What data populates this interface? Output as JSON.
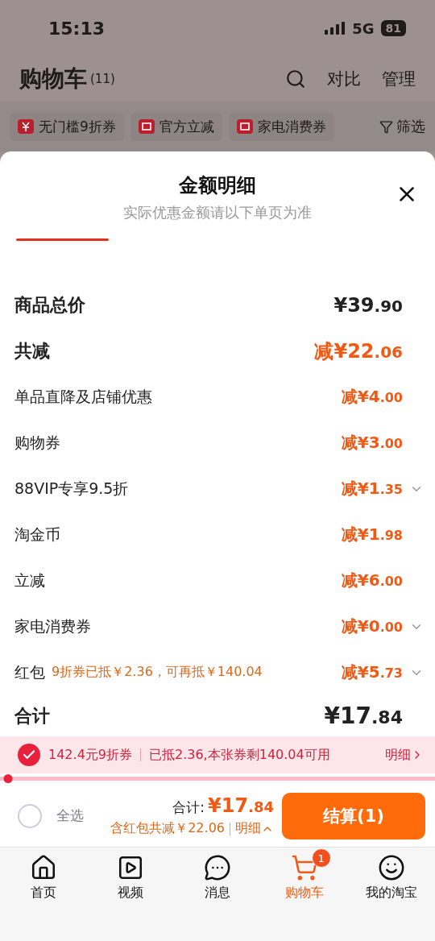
{
  "status_bar": {
    "time": "15:13",
    "network": "5G",
    "battery": "81"
  },
  "header": {
    "title": "购物车",
    "count": "(11)",
    "actions": [
      "对比",
      "管理"
    ]
  },
  "chips": [
    {
      "label": "无门槛9折券"
    },
    {
      "label": "官方立减"
    },
    {
      "label": "家电消费券"
    }
  ],
  "filter": "筛选",
  "sheet": {
    "title": "金额明细",
    "subtitle": "实际优惠金额请以下单页为准",
    "rows": [
      {
        "kind": "summary",
        "label": "商品总价",
        "amount": "¥39",
        "cents": ".90",
        "discount": false,
        "chevron": false
      },
      {
        "kind": "summary",
        "label": "共减",
        "amount": "减¥22",
        "cents": ".06",
        "discount": true,
        "chevron": false
      },
      {
        "kind": "detail",
        "label": "单品直降及店铺优惠",
        "amount": "减¥4",
        "cents": ".00",
        "discount": true,
        "chevron": false
      },
      {
        "kind": "detail",
        "label": "购物券",
        "amount": "减¥3",
        "cents": ".00",
        "discount": true,
        "chevron": false
      },
      {
        "kind": "detail",
        "label": "88VIP专享9.5折",
        "amount": "减¥1",
        "cents": ".35",
        "discount": true,
        "chevron": true
      },
      {
        "kind": "detail",
        "label": "淘金币",
        "amount": "减¥1",
        "cents": ".98",
        "discount": true,
        "chevron": false
      },
      {
        "kind": "detail",
        "label": "立减",
        "amount": "减¥6",
        "cents": ".00",
        "discount": true,
        "chevron": false
      },
      {
        "kind": "detail",
        "label": "家电消费券",
        "amount": "减¥0",
        "cents": ".00",
        "discount": true,
        "chevron": true
      },
      {
        "kind": "detail",
        "label": "红包",
        "note": "9折券已抵￥2.36，可再抵￥140.04",
        "amount": "减¥5",
        "cents": ".73",
        "discount": true,
        "chevron": true
      },
      {
        "kind": "total",
        "label": "合计",
        "amount": "¥17",
        "cents": ".84",
        "discount": false,
        "chevron": false
      }
    ]
  },
  "coupon": {
    "checked": true,
    "name": "142.4元9折券",
    "info": "已抵2.36,本张券剩140.04可用",
    "link": "明细",
    "level": 0.01
  },
  "checkout": {
    "select_all": {
      "label": "全选",
      "checked": false
    },
    "total_label": "合计:",
    "total": "¥17",
    "total_cents": ".84",
    "savings": "含红包共减￥22.06",
    "detail_link": "明细",
    "button": "结算(1)"
  },
  "tabs": [
    {
      "label": "首页",
      "selected": false
    },
    {
      "label": "视频",
      "selected": false
    },
    {
      "label": "消息",
      "selected": false
    },
    {
      "label": "购物车",
      "selected": true,
      "badge": "1"
    },
    {
      "label": "我的淘宝",
      "selected": false
    }
  ]
}
